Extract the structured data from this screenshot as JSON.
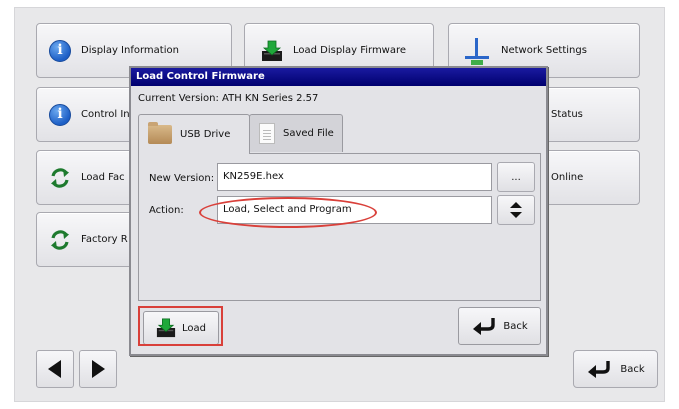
{
  "tiles": {
    "display_information": "Display Information",
    "load_display_firmware": "Load Display Firmware",
    "network_settings": "Network Settings",
    "control_info": "Control In",
    "status": "Status",
    "load_factory": "Load Fac",
    "online": "Online",
    "factory_reset": "Factory R"
  },
  "nav": {
    "back_label": "Back"
  },
  "dialog": {
    "title": "Load Control Firmware",
    "current_version": "Current Version: ATH KN Series 2.57",
    "tabs": [
      "USB Drive",
      "Saved File"
    ],
    "new_version_label": "New Version:",
    "new_version_value": "KN259E.hex",
    "browse_label": "...",
    "action_label": "Action:",
    "action_value": "Load, Select and Program",
    "load_label": "Load",
    "back_label": "Back"
  },
  "icons": {
    "info": "info-icon",
    "refresh": "refresh-icon",
    "download": "download-icon",
    "network": "network-icon",
    "back": "back-arrow-icon",
    "prev": "triangle-left-icon",
    "next": "triangle-right-icon",
    "updown": "up-down-arrows-icon"
  },
  "colors": {
    "title_bar": "#00006e",
    "highlight": "#d9403a",
    "info_blue": "#1d5fc6",
    "refresh_green": "#1e7a2e"
  }
}
